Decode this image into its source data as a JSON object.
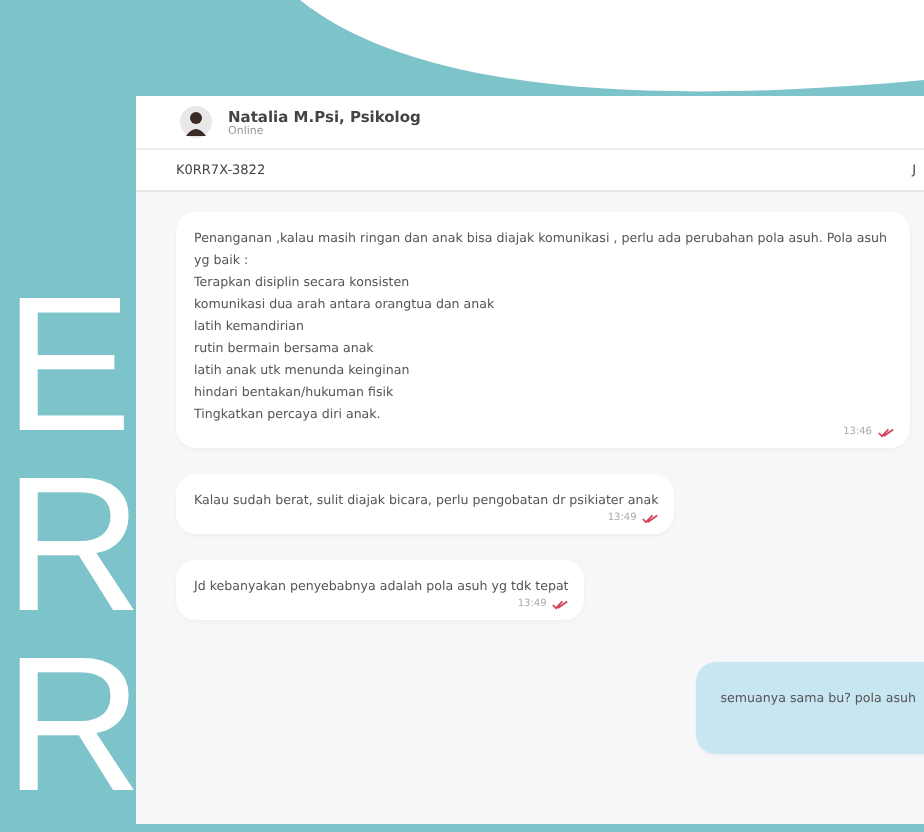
{
  "background_letters": [
    "E",
    "R",
    "R"
  ],
  "chat": {
    "contact": {
      "name": "Natalia M.Psi, Psikolog",
      "status": "Online"
    },
    "order_id": "K0RR7X-3822",
    "header_right": "J",
    "messages": [
      {
        "kind": "received",
        "lines": [
          "Penanganan ,kalau masih ringan dan anak bisa diajak komunikasi , perlu ada perubahan pola asuh. Pola asuh yg baik :",
          " Terapkan disiplin secara konsisten",
          "komunikasi dua arah antara orangtua dan anak",
          "latih kemandirian",
          "rutin bermain bersama anak",
          "latih anak utk menunda keinginan",
          "hindari bentakan/hukuman fisik",
          "Tingkatkan percaya diri anak."
        ],
        "time": "13:46"
      },
      {
        "kind": "received",
        "lines": [
          "Kalau sudah berat, sulit diajak bicara, perlu pengobatan dr psikiater anak"
        ],
        "time": "13:49"
      },
      {
        "kind": "received",
        "lines": [
          "Jd kebanyakan penyebabnya adalah pola asuh yg tdk tepat"
        ],
        "time": "13:49"
      },
      {
        "kind": "sent",
        "lines": [
          "semuanya sama bu? pola asuh"
        ]
      }
    ]
  }
}
